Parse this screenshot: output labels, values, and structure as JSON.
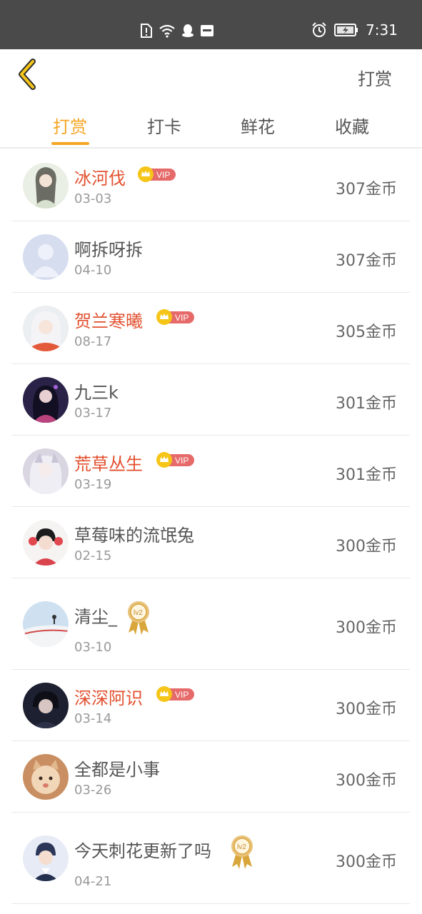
{
  "status_bar": {
    "time": "7:31"
  },
  "nav": {
    "title": "打赏"
  },
  "tabs": [
    {
      "label": "打赏",
      "active": true
    },
    {
      "label": "打卡",
      "active": false
    },
    {
      "label": "鲜花",
      "active": false
    },
    {
      "label": "收藏",
      "active": false
    }
  ],
  "badges": {
    "vip": "VIP",
    "level": "lv2"
  },
  "accent_color": "#f5a623",
  "vip_name_color": "#e2502f",
  "rows": [
    {
      "name": "冰河伐",
      "date": "03-03",
      "amount": "307金币",
      "badge": "vip"
    },
    {
      "name": "啊拆呀拆",
      "date": "04-10",
      "amount": "307金币",
      "badge": "none"
    },
    {
      "name": "贺兰寒曦",
      "date": "08-17",
      "amount": "305金币",
      "badge": "vip"
    },
    {
      "name": "九三k",
      "date": "03-17",
      "amount": "301金币",
      "badge": "none"
    },
    {
      "name": "荒草丛生",
      "date": "03-19",
      "amount": "301金币",
      "badge": "vip"
    },
    {
      "name": "草莓味的流氓兔",
      "date": "02-15",
      "amount": "300金币",
      "badge": "none"
    },
    {
      "name": "清尘_",
      "date": "03-10",
      "amount": "300金币",
      "badge": "level"
    },
    {
      "name": "深深阿识",
      "date": "03-14",
      "amount": "300金币",
      "badge": "vip"
    },
    {
      "name": "全都是小事",
      "date": "03-26",
      "amount": "300金币",
      "badge": "none"
    },
    {
      "name": "今天刺花更新了吗",
      "date": "04-21",
      "amount": "300金币",
      "badge": "level"
    }
  ]
}
